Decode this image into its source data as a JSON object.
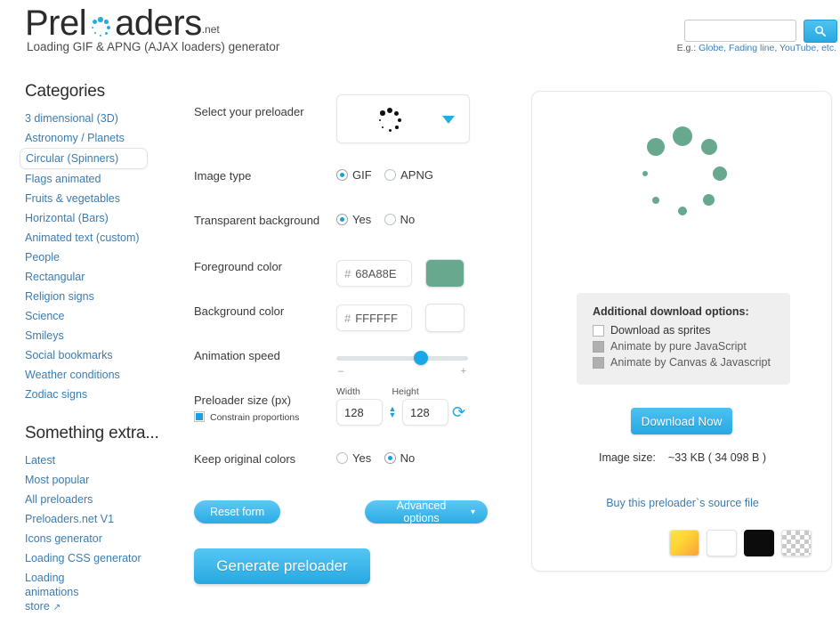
{
  "header": {
    "logo_text_1": "Prel",
    "logo_text_2": "aders",
    "logo_suffix": ".net",
    "tagline": "Loading GIF & APNG (AJAX loaders) generator",
    "search_value": "",
    "search_placeholder": "",
    "search_icon": "search-icon",
    "search_hint_prefix": "E.g.: ",
    "search_hint_links": "Globe, Fading line, YouTube, etc."
  },
  "sidebar": {
    "categories_title": "Categories",
    "categories": [
      {
        "label": "3 dimensional (3D)",
        "active": false
      },
      {
        "label": "Astronomy / Planets",
        "active": false
      },
      {
        "label": "Circular (Spinners)",
        "active": true
      },
      {
        "label": "Flags animated",
        "active": false
      },
      {
        "label": "Fruits & vegetables",
        "active": false
      },
      {
        "label": "Horizontal (Bars)",
        "active": false
      },
      {
        "label": "Animated text (custom)",
        "active": false
      },
      {
        "label": "People",
        "active": false
      },
      {
        "label": "Rectangular",
        "active": false
      },
      {
        "label": "Religion signs",
        "active": false
      },
      {
        "label": "Science",
        "active": false
      },
      {
        "label": "Smileys",
        "active": false
      },
      {
        "label": "Social bookmarks",
        "active": false
      },
      {
        "label": "Weather conditions",
        "active": false
      },
      {
        "label": "Zodiac signs",
        "active": false
      }
    ],
    "extra_title": "Something extra...",
    "extra": [
      {
        "label": "Latest",
        "external": false
      },
      {
        "label": "Most popular",
        "external": false
      },
      {
        "label": "All preloaders",
        "external": false
      },
      {
        "label": "Preloaders.net V1",
        "external": false
      },
      {
        "label": "Icons generator",
        "external": false
      },
      {
        "label": "Loading CSS generator",
        "external": false
      },
      {
        "label": "Loading animations store",
        "external": true
      }
    ]
  },
  "form": {
    "select_preloader_label": "Select your preloader",
    "select_preloader_icon": "spinner-dots-icon",
    "select_caret_icon": "chevron-down-icon",
    "image_type_label": "Image type",
    "image_type_options": [
      "GIF",
      "APNG"
    ],
    "image_type_selected": "GIF",
    "transparent_bg_label": "Transparent background",
    "transparent_bg_options": [
      "Yes",
      "No"
    ],
    "transparent_bg_selected": "Yes",
    "foreground_label": "Foreground color",
    "foreground_hash": "#",
    "foreground_value": "68A88E",
    "foreground_color": "#68A88E",
    "background_label": "Background color",
    "background_hash": "#",
    "background_value": "FFFFFF",
    "background_color": "#FFFFFF",
    "animation_speed_label": "Animation speed",
    "animation_speed_percent": 64,
    "slider_minus": "–",
    "slider_plus": "+",
    "size_label": "Preloader size (px)",
    "constrain_label": "Constrain proportions",
    "constrain_checked": true,
    "width_header": "Width",
    "height_header": "Height",
    "width_value": "128",
    "height_value": "128",
    "refresh_icon": "refresh-icon",
    "keep_colors_label": "Keep original colors",
    "keep_colors_options": [
      "Yes",
      "No"
    ],
    "keep_colors_selected": "No",
    "reset_label": "Reset form",
    "advanced_label": "Advanced options",
    "advanced_caret": "▾",
    "generate_label": "Generate preloader"
  },
  "preview": {
    "spinner_color": "#68A88E",
    "dl_options_title": "Additional download options:",
    "dl_options": [
      {
        "label": "Download as sprites",
        "disabled": false,
        "checked": false
      },
      {
        "label": "Animate by pure JavaScript",
        "disabled": true,
        "checked": false
      },
      {
        "label": "Animate by Canvas & Javascript",
        "disabled": true,
        "checked": false
      }
    ],
    "download_label": "Download Now",
    "image_size_key": "Image size:",
    "image_size_value": "~33 KB ( 34 098 B )",
    "buy_link": "Buy this preloader`s source file",
    "bg_swatches": [
      "gradient",
      "white",
      "black",
      "checker"
    ]
  }
}
